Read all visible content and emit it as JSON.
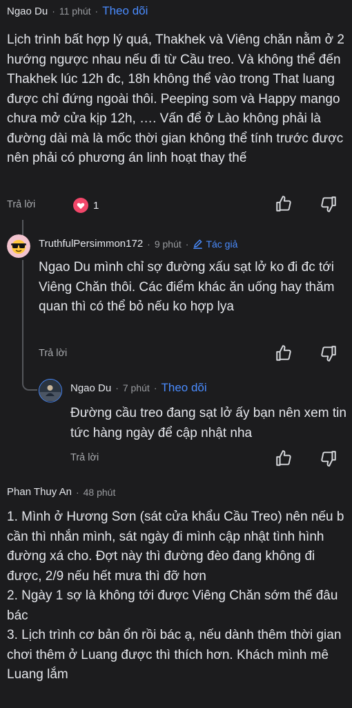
{
  "comment1": {
    "author": "Ngao Du",
    "time": "11 phút",
    "follow": "Theo dõi",
    "body": "Lịch trình bất hợp lý quá, Thakhek và Viêng chăn nằm ở 2 hướng ngược nhau nếu đi từ Cầu treo. Và không thể đến Thakhek lúc 12h đc, 18h không thể vào trong That luang được chỉ đứng ngoài thôi. Peeping som và Happy mango chưa mở cửa kịp 12h, …. Vấn để ở Lào không phải là đường dài mà là mốc thời gian không thể tính trước được nên phải có phương án linh hoạt thay thế",
    "reply": "Trả lời",
    "reaction_count": "1"
  },
  "reply1": {
    "author": "TruthfulPersimmon172",
    "time": "9 phút",
    "author_tag": "Tác giả",
    "body": "Ngao Du mình chỉ sợ đường xấu sạt lở ko đi đc tới Viêng Chăn thôi. Các điểm khác ăn uống hay thăm quan thì có thể bỏ nếu ko hợp lya",
    "reply": "Trả lời"
  },
  "reply2": {
    "author": "Ngao Du",
    "time": "7 phút",
    "follow": "Theo dõi",
    "body": "Đường cầu treo đang sạt lở ấy bạn nên xem tin tức hàng ngày để cập nhật nha",
    "reply": "Trả lời"
  },
  "comment2": {
    "author": "Phan Thuy An",
    "time": "48 phút",
    "body": "1. Mình ở Hương Sơn (sát cửa khẩu Cầu Treo) nên nếu b cần thì nhắn mình, sát ngày đi mình cập nhật tình hình đường xá cho. Đợt này thì đường đèo đang không đi được, 2/9 nếu hết mưa thì đỡ hơn\n2. Ngày 1 sợ là không tới được Viêng Chăn sớm thế đâu bác\n3. Lịch trình cơ bản ổn rồi bác ạ, nếu dành thêm thời gian chơi thêm ở Luang được thì thích hơn. Khách mình mê Luang lắm"
  },
  "colors": {
    "background": "#1c1c1e",
    "accent": "#4a8cff",
    "reaction": "#f2476a"
  },
  "icons": [
    "heart-icon",
    "thumbs-up-icon",
    "thumbs-down-icon",
    "pencil-icon",
    "sunglasses-avatar",
    "profile-avatar"
  ]
}
